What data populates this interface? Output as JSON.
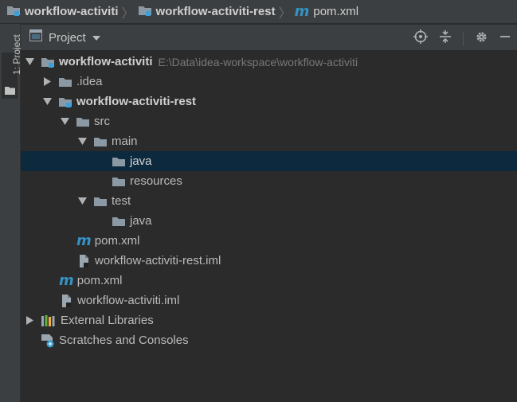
{
  "breadcrumb": {
    "items": [
      {
        "label": "workflow-activiti",
        "icon": "module-folder-icon"
      },
      {
        "label": "workflow-activiti-rest",
        "icon": "module-folder-icon"
      },
      {
        "label": "pom.xml",
        "icon": "maven-icon"
      }
    ],
    "separator": "〉"
  },
  "tool_window": {
    "label": "1: Project"
  },
  "panel": {
    "view_label": "Project",
    "maven_glyph": "m"
  },
  "tree": {
    "root": {
      "label": "workflow-activiti",
      "path": "E:\\Data\\idea-workspace\\workflow-activiti"
    },
    "idea": {
      "label": ".idea"
    },
    "rest_module": {
      "label": "workflow-activiti-rest"
    },
    "src": {
      "label": "src"
    },
    "main": {
      "label": "main"
    },
    "java_main": {
      "label": "java"
    },
    "resources": {
      "label": "resources"
    },
    "test": {
      "label": "test"
    },
    "java_test": {
      "label": "java"
    },
    "rest_pom": {
      "label": "pom.xml"
    },
    "rest_iml": {
      "label": "workflow-activiti-rest.iml"
    },
    "root_pom": {
      "label": "pom.xml"
    },
    "root_iml": {
      "label": "workflow-activiti.iml"
    },
    "external_libraries": {
      "label": "External Libraries"
    },
    "scratches": {
      "label": "Scratches and Consoles"
    }
  },
  "colors": {
    "background": "#2b2b2b",
    "toolbar": "#3c3f41",
    "selection": "#0d293e",
    "maven": "#3592c4",
    "folder": "#8b99a5",
    "module_badge": "#3d9fd6"
  }
}
